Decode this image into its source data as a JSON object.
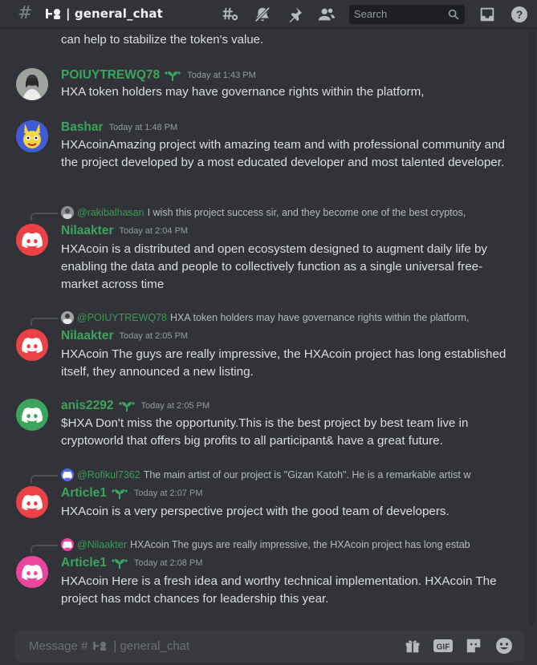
{
  "header": {
    "channel_name": "| general_chat",
    "search_placeholder": "Search"
  },
  "top_line": "can help to stabilize the token's value.",
  "messages": [
    {
      "username": "POIUYTREWQ78",
      "name_color": "#3ba55d",
      "timestamp": "Today at 1:43 PM",
      "text": "HXA token holders may have governance rights within the platform,"
    },
    {
      "username": "Bashar",
      "name_color": "#3ba55d",
      "timestamp": "Today at 1:48 PM",
      "text": "HXAcoinAmazing project with amazing team and with professional community and the project developed by a most educated developer and most talented developer."
    },
    {
      "reply_to": "@rakibalhasan",
      "reply_text": "I wish this project success sir, and they become one of the best cryptos,",
      "username": "Nilaakter",
      "name_color": "#3ba55d",
      "timestamp": "Today at 2:04 PM",
      "text": "HXAcoin is a distributed and open ecosystem designed to augment daily life by enabling the data and people to collectively function as a single universal free-market across time"
    },
    {
      "reply_to": "@POIUYTREWQ78",
      "reply_text": "HXA token holders may have governance rights within the platform,",
      "username": "Nilaakter",
      "name_color": "#3ba55d",
      "timestamp": "Today at 2:05 PM",
      "text": "HXAcoin The guys are really impressive, the HXAcoin project has long established itself, they announced a new listing."
    },
    {
      "username": "anis2292",
      "name_color": "#3ba55d",
      "timestamp": "Today at 2:05 PM",
      "text": "$HXA Don't miss the opportunity.This is the best project by best team live in cryptoworld that offers big profits to all participant& have a great future."
    },
    {
      "reply_to": "@Rofikul7362",
      "reply_text": "The main artist of our project is \"Gizan Katoh\". He is a remarkable artist w",
      "username": "Article1",
      "name_color": "#3ba55d",
      "timestamp": "Today at 2:07 PM",
      "text": "HXAcoin is a very perspective project with the good team of developers."
    },
    {
      "reply_to": "@Nilaakter",
      "reply_text": "HXAcoin The guys are really impressive, the HXAcoin project has long estab",
      "username": "Article1",
      "name_color": "#3ba55d",
      "timestamp": "Today at 2:08 PM",
      "text": "HXAcoin Here is a fresh idea and worthy technical implementation. HXAcoin The project has mdct chances for leadership this year."
    }
  ],
  "composer": {
    "placeholder_prefix": "Message #",
    "placeholder_channel": "| general_chat"
  },
  "colors": {
    "background": "#313338",
    "discord_red": "#ed4245",
    "discord_green": "#3ba55d",
    "username_green": "#3ba55d"
  }
}
